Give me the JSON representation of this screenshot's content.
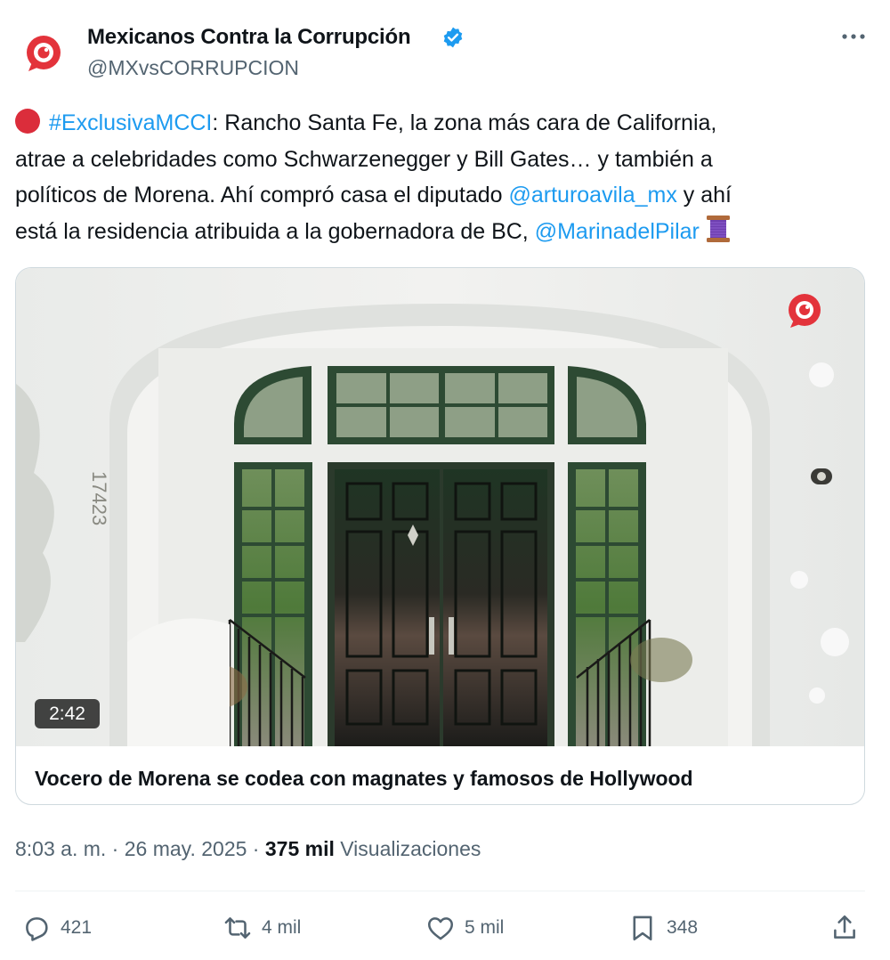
{
  "author": {
    "name": "Mexicanos Contra la Corrupción",
    "handle": "@MXvsCORRUPCION",
    "brand_color": "#e3333b",
    "verified_color": "#1d9bf0"
  },
  "tweet": {
    "hashtag": "#ExclusivaMCCI",
    "line1_rest": ": Rancho Santa Fe, la zona más cara de California,",
    "line2": "atrae a celebridades como Schwarzenegger y Bill Gates… y también a",
    "line3_pre": "políticos de Morena. Ahí compró casa el diputado ",
    "mention1": "@arturoavila_mx",
    "line3_post": " y ahí",
    "line4_pre": "está la residencia atribuida a la gobernadora de BC, ",
    "mention2": "@MarinadelPilar",
    "leading_icon": "red-circle-emoji",
    "trailing_icon": "thread-spool-emoji"
  },
  "card": {
    "title": "Vocero de Morena se codea con magnates y famosos de Hollywood",
    "duration": "2:42",
    "house_number": "17423",
    "watermark_icon": "mcci-logo-icon"
  },
  "meta": {
    "time": "8:03 a. m.",
    "separator": " · ",
    "date": "26 may. 2025",
    "views_count": "375 mil",
    "views_label": "Visualizaciones"
  },
  "actions": {
    "replies": "421",
    "reposts": "4 mil",
    "likes": "5 mil",
    "bookmarks": "348"
  },
  "colors": {
    "text": "#0f1419",
    "muted": "#536471",
    "link": "#1d9bf0",
    "door_green": "#1f3524"
  }
}
